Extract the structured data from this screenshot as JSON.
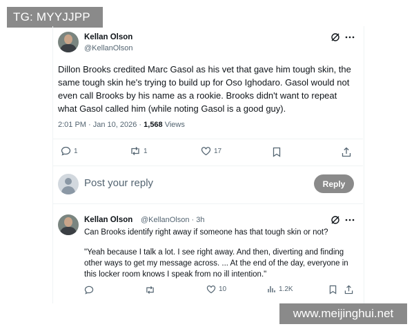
{
  "watermarks": {
    "top_left": "TG: MYYJJPP",
    "bottom_right": "www.meijinghui.net"
  },
  "tweet": {
    "author_name": "Kellan Olson",
    "author_handle": "@KellanOlson",
    "text": "Dillon Brooks credited Marc Gasol as his vet that gave him tough skin, the same tough skin he's trying to build up for Oso Ighodaro. Gasol would not even call Brooks by his name as a rookie. Brooks didn't want to repeat what Gasol called him (while noting Gasol is a good guy).",
    "time": "2:01 PM · Jan 10, 2026 · ",
    "views_count": "1,568",
    "views_label": " Views",
    "actions": {
      "replies": "1",
      "reposts": "1",
      "likes": "17"
    }
  },
  "reply_box": {
    "placeholder": "Post your reply",
    "button": "Reply"
  },
  "reply": {
    "author_name": "Kellan Olson",
    "author_handle": "@KellanOlson · 3h",
    "line1": "Can Brooks identify right away if someone has that tough skin or not?",
    "line2": "\"Yeah because I talk a lot. I see right away. And then, diverting and finding other ways to get my message across. ... At the end of the day, everyone in this locker room knows I speak from no ill intention.\"",
    "actions": {
      "likes": "10",
      "views": "1.2K"
    }
  },
  "icons": [
    "grok-icon",
    "more-icon",
    "reply-icon",
    "repost-icon",
    "like-icon",
    "bookmark-icon",
    "share-icon",
    "analytics-icon"
  ]
}
